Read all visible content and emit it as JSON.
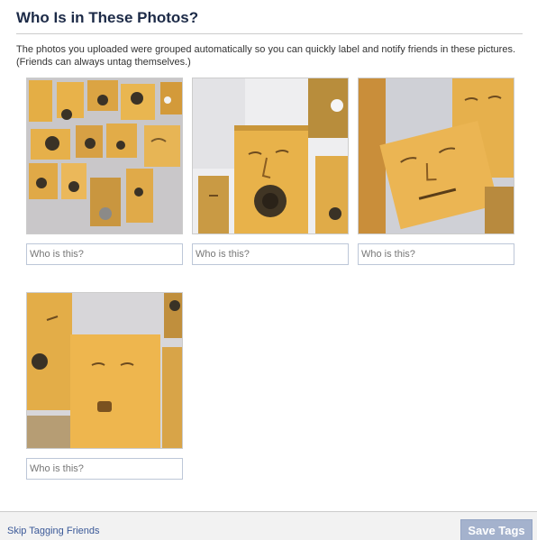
{
  "dialog": {
    "title": "Who Is in These Photos?",
    "description_line1": "The photos you uploaded were grouped automatically so you can quickly label and notify friends in these pictures.",
    "description_line2": "(Friends can always untag themselves.)"
  },
  "faces": [
    {
      "input_placeholder": "Who is this?",
      "input_value": ""
    },
    {
      "input_placeholder": "Who is this?",
      "input_value": ""
    },
    {
      "input_placeholder": "Who is this?",
      "input_value": ""
    },
    {
      "input_placeholder": "Who is this?",
      "input_value": ""
    }
  ],
  "footer": {
    "skip_label": "Skip Tagging Friends",
    "save_label": "Save Tags"
  },
  "colors": {
    "title": "#1c2a47",
    "link": "#3b5998",
    "save_button_bg": "#a4b2cd",
    "face_box": "#e8b24a",
    "wall": "#d9d9dd"
  }
}
